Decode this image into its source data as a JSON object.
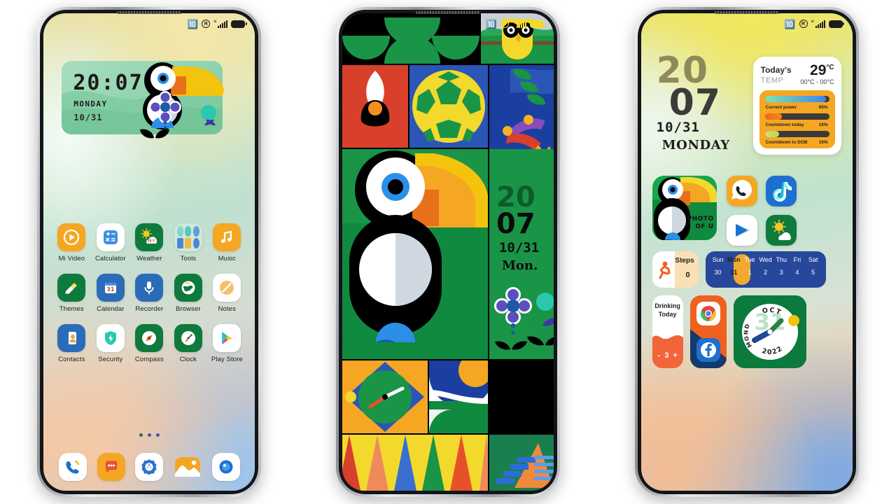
{
  "scene": {
    "title": "MIUI theme preview - three phone home screens",
    "phone_count": 3
  },
  "statusbar": {
    "bluetooth_icon": "bluetooth-icon",
    "dnd_icon": "do-not-disturb-icon",
    "vibrate_icon": "vibrate-icon",
    "signal_icon": "signal-bars-icon",
    "battery_icon": "battery-full-icon"
  },
  "phone1": {
    "widget": {
      "time": "20:07",
      "day": "MONDAY",
      "date": "10/31"
    },
    "apps": [
      [
        {
          "label": "Mi Video",
          "icon": "mi-video-icon",
          "bg": "#f5a623"
        },
        {
          "label": "Calculator",
          "icon": "calculator-icon",
          "bg": "#ffffff"
        },
        {
          "label": "Weather",
          "icon": "weather-icon",
          "bg": "#0e7a3c"
        },
        {
          "label": "Tools",
          "icon": "tools-folder-icon",
          "bg": "#cfe9d6"
        },
        {
          "label": "Music",
          "icon": "music-icon",
          "bg": "#f5a623"
        }
      ],
      [
        {
          "label": "Themes",
          "icon": "themes-icon",
          "bg": "#0e7a3c"
        },
        {
          "label": "Calendar",
          "icon": "calendar-icon",
          "bg": "#2b6cb8"
        },
        {
          "label": "Recorder",
          "icon": "recorder-icon",
          "bg": "#2b6cb8"
        },
        {
          "label": "Browser",
          "icon": "browser-icon",
          "bg": "#0e7a3c"
        },
        {
          "label": "Notes",
          "icon": "notes-icon",
          "bg": "#ffffff"
        }
      ],
      [
        {
          "label": "Contacts",
          "icon": "contacts-icon",
          "bg": "#2b6cb8"
        },
        {
          "label": "Security",
          "icon": "security-icon",
          "bg": "#ffffff"
        },
        {
          "label": "Compass",
          "icon": "compass-icon",
          "bg": "#0e7a3c"
        },
        {
          "label": "Clock",
          "icon": "clock-icon",
          "bg": "#0e7a3c"
        },
        {
          "label": "Play Store",
          "icon": "play-store-icon",
          "bg": "#ffffff"
        }
      ]
    ],
    "page_dots": 3,
    "dock": [
      {
        "label": "Phone",
        "icon": "phone-icon"
      },
      {
        "label": "Messages",
        "icon": "messages-icon"
      },
      {
        "label": "Settings",
        "icon": "settings-icon"
      },
      {
        "label": "Gallery",
        "icon": "gallery-icon"
      },
      {
        "label": "Camera",
        "icon": "camera-icon"
      }
    ]
  },
  "phone2": {
    "wallpaper_name": "toucan-collage-wallpaper",
    "clock": {
      "hour": "20",
      "minute": "07",
      "date": "10/31",
      "day": "Mon."
    },
    "tiles": [
      "green-arches-tile",
      "owl-on-branch-tile",
      "rocket-tile",
      "soccer-ball-tile",
      "bird-feathers-tile",
      "toucan-tile",
      "clock-face-tile",
      "abstract-curve-tile",
      "flower-plants-tile",
      "triangles-tile",
      "stairs-tile"
    ]
  },
  "phone3": {
    "clock": {
      "hour": "20",
      "minute": "07",
      "date": "10/31",
      "day": "MONDAY"
    },
    "weather_card": {
      "title": "Today's",
      "subtitle": "TEMP",
      "temp": "29",
      "unit": "°C",
      "range": "00°C - 00°C",
      "bars": [
        {
          "label": "Current power",
          "value": "95%",
          "pct": 95,
          "color": "linear-gradient(90deg,#7fe3b0,#3f86e8)"
        },
        {
          "label": "Countdown today",
          "value": "16%",
          "pct": 26,
          "color": "linear-gradient(90deg,#f2651e,#f08a1a)"
        },
        {
          "label": "Countdown to DOB",
          "value": "16%",
          "pct": 22,
          "color": "linear-gradient(90deg,#cfe07a,#b6d64f)"
        }
      ]
    },
    "photo_widget": {
      "line1": "PHOTO",
      "line2": "OF U"
    },
    "apps": [
      {
        "label": "WhatsApp",
        "icon": "whatsapp-icon"
      },
      {
        "label": "TikTok",
        "icon": "tiktok-icon"
      },
      {
        "label": "Mi Video",
        "icon": "mi-video-play-icon"
      },
      {
        "label": "Weather",
        "icon": "weather-sun-cloud-icon"
      }
    ],
    "steps_widget": {
      "label": "Steps",
      "value": "0",
      "icon": "running-person-icon"
    },
    "calendar_widget": {
      "weekdays": [
        "Sun",
        "Mon",
        "Tue",
        "Wed",
        "Thu",
        "Fri",
        "Sat"
      ],
      "dates": [
        "30",
        "31",
        "1",
        "2",
        "3",
        "4",
        "5"
      ],
      "selected_index": 1
    },
    "drink_widget": {
      "line1": "Drinking",
      "line2": "Today",
      "minus": "-",
      "count": "3",
      "plus": "+"
    },
    "shortcut_stack": [
      {
        "label": "Chrome",
        "icon": "chrome-icon"
      },
      {
        "label": "Facebook",
        "icon": "facebook-icon"
      }
    ],
    "clock_widget": {
      "month": "OCT",
      "day_number": "31",
      "weekday": "MONDAY",
      "year": "2022"
    }
  },
  "colors": {
    "green": "#0e7a3c",
    "bright_green": "#17a64a",
    "orange": "#f5a623",
    "blue": "#2b6cb8",
    "navy": "#27479b",
    "yellow": "#f2d92b",
    "red": "#d8402c"
  }
}
